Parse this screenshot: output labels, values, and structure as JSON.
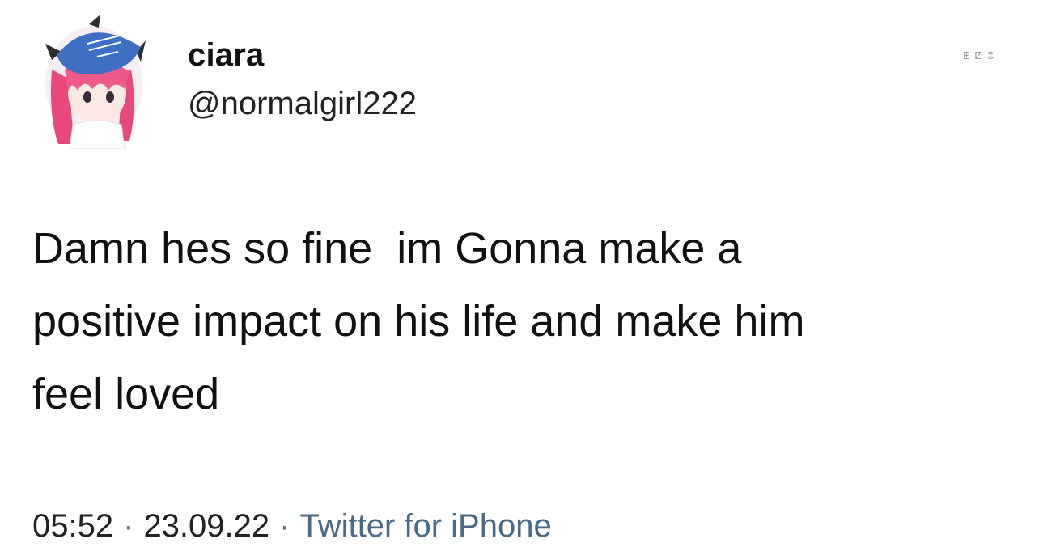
{
  "tweet": {
    "author": {
      "display_name": "ciara",
      "handle": "@normalgirl222",
      "avatar_icon": "anime-girl-avatar"
    },
    "corner_mark": "ⵟ ⵇ ⵓ",
    "text": "Damn hes so fine  im Gonna make a\npositive impact on his life and make him\nfeel loved",
    "time": "05:52",
    "separator": "·",
    "date": "23.09.22",
    "source": "Twitter for iPhone"
  },
  "colors": {
    "text": "#111111",
    "source_link": "#4a6a86",
    "hat_blue": "#3f6fc4",
    "hair_pink": "#e8487a"
  }
}
